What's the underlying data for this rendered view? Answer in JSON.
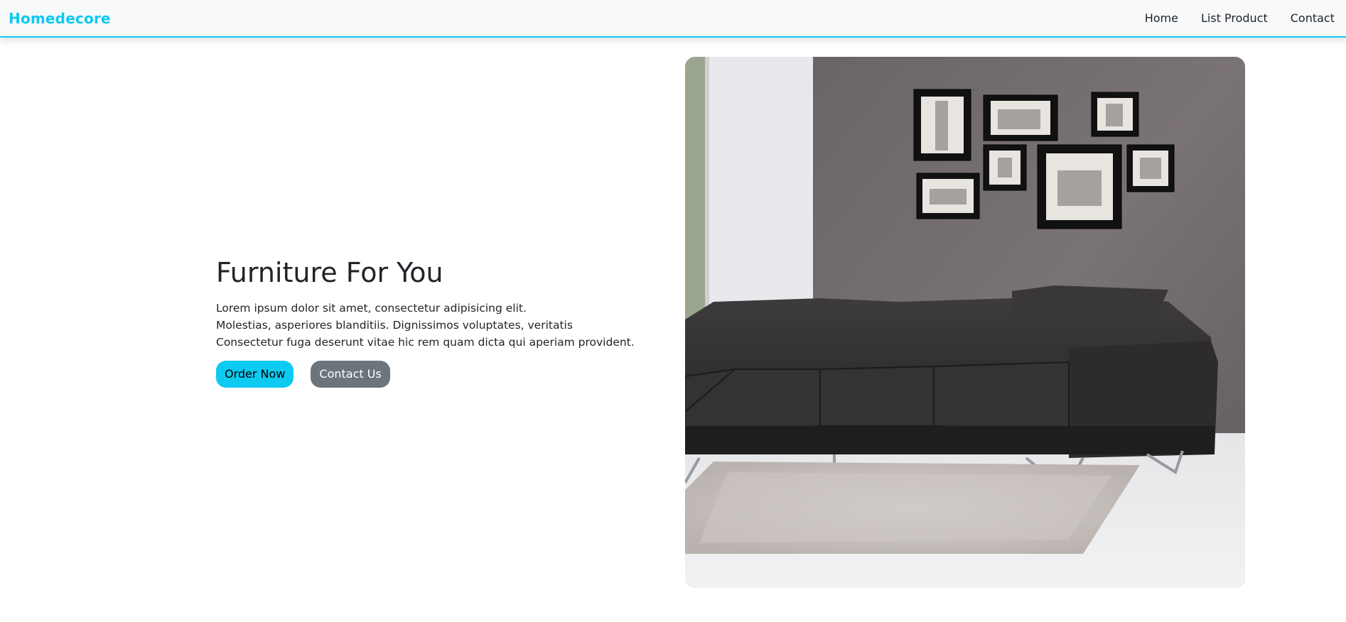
{
  "navbar": {
    "brand": "Homedecore",
    "links": [
      {
        "label": "Home"
      },
      {
        "label": "List Product"
      },
      {
        "label": "Contact"
      }
    ]
  },
  "hero": {
    "title": "Furniture For You",
    "text_lines": [
      "Lorem ipsum dolor sit amet, consectetur adipisicing elit.",
      "Molestias, asperiores blanditiis. Dignissimos voluptates, veritatis",
      "Consectetur fuga deserunt vitae hic rem quam dicta qui aperiam provident."
    ],
    "order_button": "Order Now",
    "contact_button": "Contact Us"
  },
  "colors": {
    "accent": "#0dcaf0",
    "secondary": "#6c757d",
    "navbar_bg": "#f8f9fa"
  }
}
